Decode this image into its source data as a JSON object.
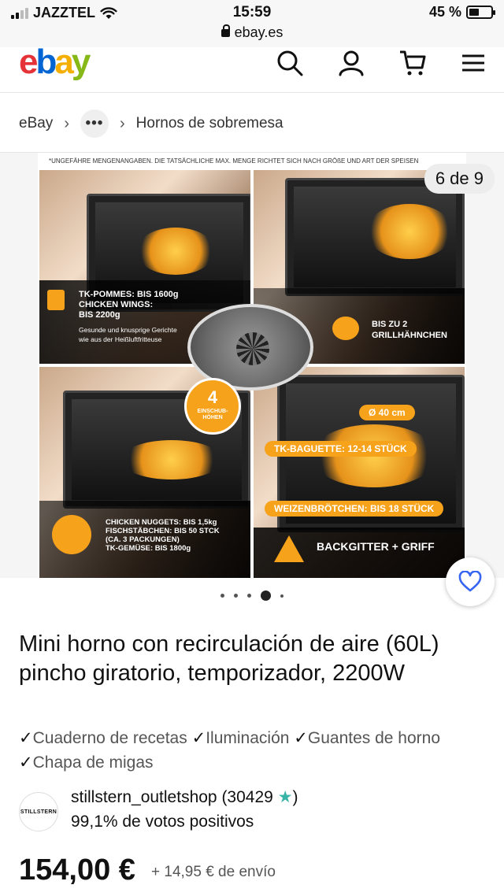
{
  "status_bar": {
    "carrier": "JAZZTEL",
    "time": "15:59",
    "battery": "45 %",
    "url": "ebay.es"
  },
  "header": {
    "logo": {
      "e": "e",
      "b": "b",
      "a": "a",
      "y": "y"
    },
    "icons": [
      "search-icon",
      "user-icon",
      "cart-icon",
      "menu-icon"
    ]
  },
  "breadcrumb": {
    "root": "eBay",
    "more": "•••",
    "current": "Hornos de sobremesa"
  },
  "gallery": {
    "counter": "6 de 9",
    "image": {
      "note": "*UNGEFÄHRE MENGENANGABEN. DIE TATSÄCHLICHE MAX. MENGE RICHTET SICH NACH GRÖßE UND ART DER SPEISEN",
      "p1_title": "TK-POMMES: BIS 1600g",
      "p1_title2": "CHICKEN WINGS:",
      "p1_title3": "BIS 2200g",
      "p1_sub": "Gesunde und knusprige Gerichte",
      "p1_sub2": "wie aus der Heißluftfritteuse",
      "p2_title": "BIS ZU 2",
      "p2_title2": "GRILLHÄHNCHEN",
      "badge_num": "4",
      "badge_text": "EINSCHUB-",
      "badge_text2": "HÖHEN",
      "p3_l1": "CHICKEN NUGGETS: BIS 1,5kg",
      "p3_l2": "FISCHSTÄBCHEN: BIS 50 STCK",
      "p3_l3": "(CA. 3 PACKUNGEN)",
      "p3_l4": "TK-GEMÜSE: BIS 1800g",
      "p4_diam": "Ø 40 cm",
      "p4_baguette": "TK-BAGUETTE: 12-14 STÜCK",
      "p4_rolls": "WEIZENBRÖTCHEN: BIS 18 STÜCK",
      "p4_grid": "BACKGITTER + GRIFF"
    }
  },
  "carousel": {
    "count": 5,
    "active_index": 3
  },
  "product": {
    "title": "Mini horno con recirculación de aire (60L) pincho giratorio, temporizador, 2200W",
    "features": "Cuaderno de recetas",
    "features2": "Iluminación",
    "features3": "Guantes de horno",
    "features4": "Chapa de migas",
    "check": "✓"
  },
  "seller": {
    "avatar_text": "STILLSTERN",
    "name": "stillstern_outletshop (30429",
    "star": "★",
    "name_close": ")",
    "feedback": "99,1% de votos positivos"
  },
  "pricing": {
    "price": "154,00 €",
    "shipping": "+ 14,95 € de envío"
  },
  "colors": {
    "ebay_red": "#e53238",
    "ebay_blue": "#0064d2",
    "ebay_yellow": "#f5af02",
    "ebay_green": "#86b817",
    "accent_orange": "#f7a21b",
    "wishlist_blue": "#3665f3"
  }
}
